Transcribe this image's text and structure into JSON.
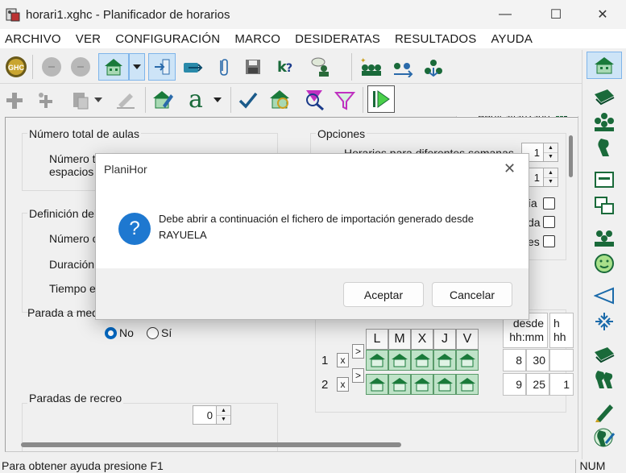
{
  "window": {
    "title": "horari1.xghc - Planificador de horarios",
    "minimize": "—",
    "maximize": "☐",
    "close": "✕"
  },
  "menu": [
    "ARCHIVO",
    "VER",
    "CONFIGURACIÓN",
    "MARCO",
    "DESIDERATAS",
    "RESULTADOS",
    "AYUDA"
  ],
  "toolbar": {
    "ghc_label": "GHC",
    "font_label": "a",
    "perfil_label": "Perfil avanzado"
  },
  "form": {
    "aulas_title": "Número total de aulas",
    "aulas_line1": "Número to",
    "aulas_line2": "espacios",
    "opciones_title": "Opciones",
    "opciones_line1": "Horarios para diferentes semanas",
    "opciones_val1": "1",
    "opciones_val2": "1",
    "opt_tail_1": "ía",
    "opt_tail_2": "da",
    "opt_tail_3": "es",
    "definicion_title": "Definición del",
    "numero_label": "Número c",
    "duracion_label": "Duración",
    "tiempo_label": "Tiempo e",
    "parada_label": "Parada a med",
    "radio_no": "No",
    "radio_si": "Sí",
    "recreo_label": "Paradas de recreo",
    "recreo_value": "0"
  },
  "schedule": {
    "days": [
      "L",
      "M",
      "X",
      "J",
      "V"
    ],
    "col_desde": "desde",
    "col_hhmm": "hh:mm",
    "col_h": "h",
    "col_hh": "hh",
    "rows": [
      {
        "num": "1",
        "x": "x",
        "arrow": ">",
        "hour": "8",
        "min": "30",
        "tail": ""
      },
      {
        "num": "2",
        "x": "x",
        "arrow": ">",
        "hour": "9",
        "min": "25",
        "tail": "1"
      }
    ]
  },
  "status": {
    "help": "Para obtener ayuda presione F1",
    "num": "NUM"
  },
  "dialog": {
    "title": "PlaniHor",
    "close": "✕",
    "icon": "?",
    "message": "Debe abrir a continuación el fichero de importación generado desde RAYUELA",
    "ok": "Aceptar",
    "cancel": "Cancelar"
  }
}
